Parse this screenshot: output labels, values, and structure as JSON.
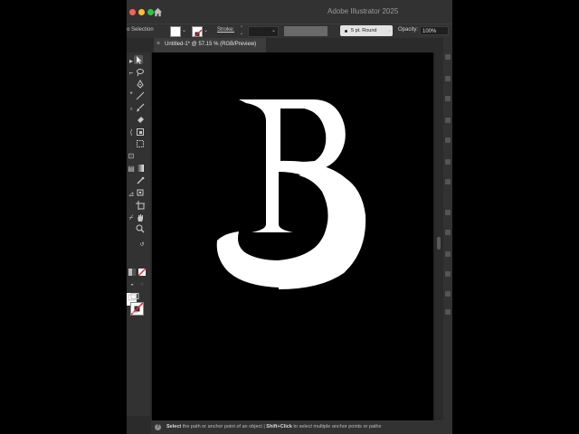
{
  "window": {
    "title": "Adobe Illustrator 2025",
    "traffic_lights": [
      "#ff5f57",
      "#febc2e",
      "#28c840"
    ]
  },
  "control_bar": {
    "selection_label": "o Selection",
    "fill_color": "#ffffff",
    "stroke_label": "Stroke:",
    "stroke_weight": "",
    "brush_label": "5 pt. Round",
    "opacity_label": "Opacity:",
    "opacity_value": "100%"
  },
  "document_tab": {
    "close_glyph": "×",
    "label": "Untitled-1* @ 57.15 % (RGB/Preview)"
  },
  "toolbar": {
    "tools": [
      "selection-tool",
      "direct-selection-tool",
      "pen-tool",
      "line-tool",
      "paintbrush-tool",
      "eraser-tool",
      "rotate-tool",
      "scale-tool",
      "free-transform-tool",
      "gradient-tool",
      "eyedropper-tool",
      "symbol-sprayer-tool",
      "artboard-tool",
      "hand-tool",
      "zoom-tool"
    ],
    "fill_color": "#ffffff",
    "stroke_color": "none",
    "more_tools_glyph": "•••"
  },
  "artboard": {
    "background": "#000000",
    "artwork": {
      "letter": "B",
      "color": "#ffffff"
    }
  },
  "status_bar": {
    "help_glyph": "?",
    "text_1a": "Select",
    "text_1b": " the path or anchor point of an object  |  ",
    "text_2a": "Shift+Click",
    "text_2b": " to select multiple anchor points or paths"
  }
}
